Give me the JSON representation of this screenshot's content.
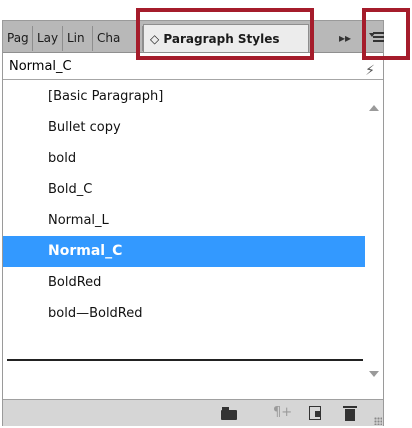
{
  "tabs": [
    {
      "label": "Pag"
    },
    {
      "label": "Lay"
    },
    {
      "label": "Lin"
    },
    {
      "label": "Cha"
    },
    {
      "label": "◇ Paragraph Styles"
    }
  ],
  "tabbar": {
    "expand_glyph": "▸▸"
  },
  "current_style": {
    "name": "Normal_C",
    "clear_glyph": "⚡"
  },
  "styles": [
    {
      "label": "[Basic Paragraph]"
    },
    {
      "label": "Bullet copy"
    },
    {
      "label": "bold"
    },
    {
      "label": "Bold_C"
    },
    {
      "label": "Normal_L"
    },
    {
      "label": "Normal_C",
      "selected": true
    },
    {
      "label": "BoldRed"
    },
    {
      "label": "bold—BoldRed"
    }
  ],
  "bottombar": {
    "clear_override_glyph": "¶+"
  },
  "colors": {
    "selection": "#3399ff",
    "highlight": "#a51c2b",
    "tabbar": "#b8b8b8"
  }
}
